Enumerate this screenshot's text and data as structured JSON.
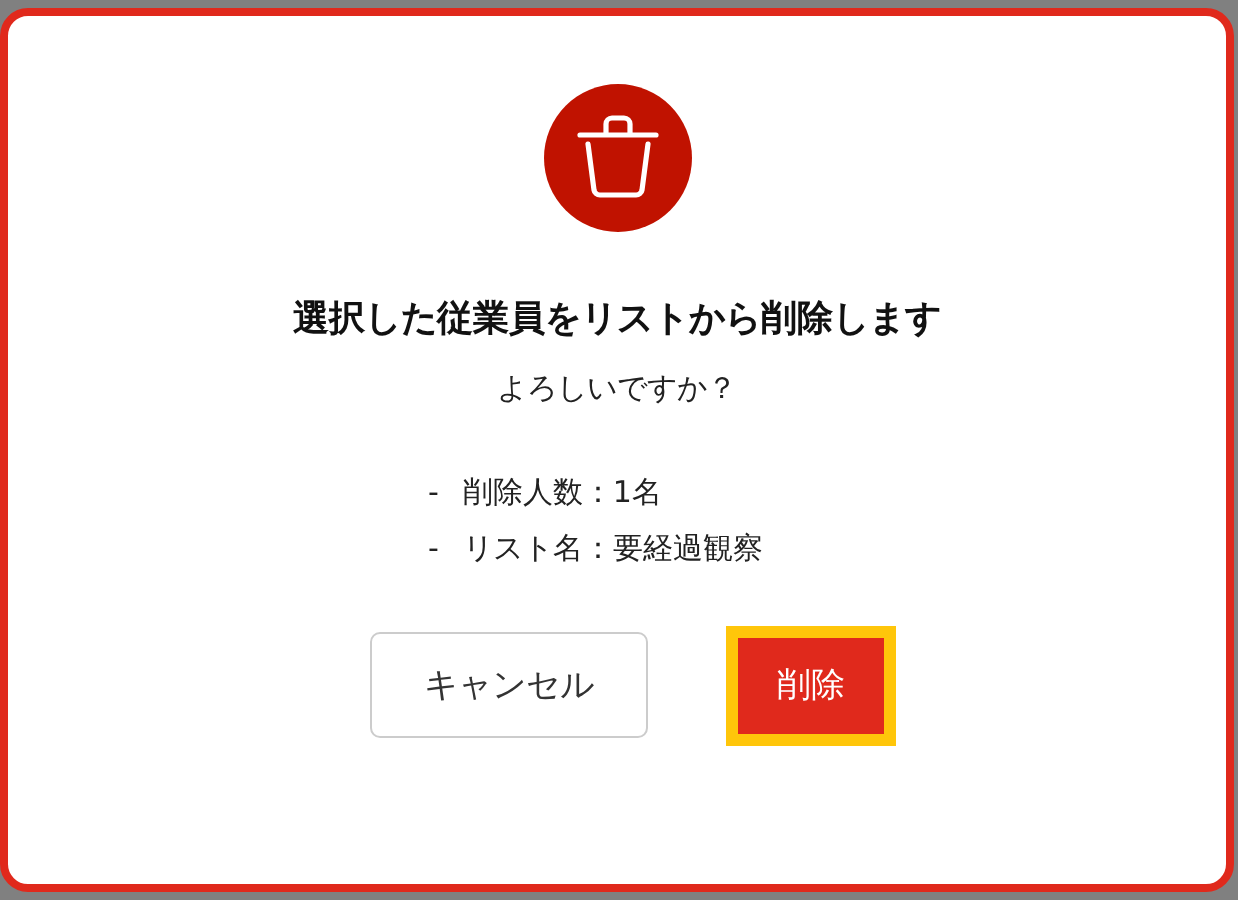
{
  "dialog": {
    "title": "選択した従業員をリストから削除します",
    "message": "よろしいですか？",
    "details": [
      {
        "bullet": "-",
        "text": "削除人数：1名"
      },
      {
        "bullet": "-",
        "text": "リスト名：要経過観察"
      }
    ],
    "buttons": [
      {
        "kind": "secondary",
        "label": "キャンセル",
        "focused": false
      },
      {
        "kind": "danger",
        "label": "削除",
        "focused": true
      }
    ]
  }
}
